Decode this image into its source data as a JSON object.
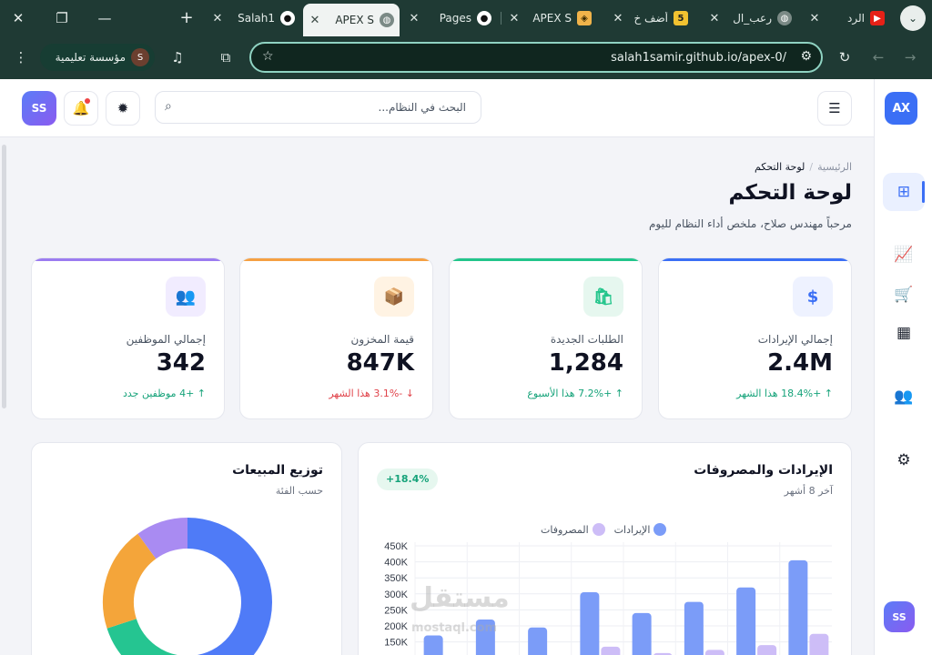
{
  "browser": {
    "tabs": [
      {
        "title": "Salah1",
        "favicon": "github-icon",
        "active": false
      },
      {
        "title": "APEX S",
        "favicon": "globe-icon",
        "active": true
      },
      {
        "title": "Pages",
        "favicon": "github-icon",
        "active": false
      },
      {
        "title": "APEX S",
        "favicon": "codepen-icon",
        "active": false
      },
      {
        "title": "أضف خ",
        "favicon": "five-icon",
        "active": false
      },
      {
        "title": "رعب_ال",
        "favicon": "globe-icon",
        "active": false
      },
      {
        "title": "الرد",
        "favicon": "youtube-icon",
        "active": false
      }
    ],
    "url": "salah1samir.github.io/apex-0/",
    "profile_name": "مؤسسة تعليمية",
    "profile_initial": "S"
  },
  "app": {
    "logo": "AX",
    "user_initials": "SS",
    "search_placeholder": "البحث في النظام...",
    "breadcrumb": {
      "home": "الرئيسية",
      "current": "لوحة التحكم"
    },
    "title": "لوحة التحكم",
    "subtitle": "مرحباً مهندس صلاح، ملخص أداء النظام لليوم",
    "sidebar_icons": [
      "dashboard-icon",
      "chart-icon",
      "cart-icon",
      "boxes-icon",
      "users-icon",
      "settings-icon"
    ]
  },
  "stats": [
    {
      "label": "إجمالي الإيرادات",
      "value": "2.4M",
      "trend": "+18.4% هذا الشهر",
      "direction": "up",
      "icon": "$",
      "accent": "#3b6ff5",
      "icon_bg": "#eef2ff"
    },
    {
      "label": "الطلبات الجديدة",
      "value": "1,284",
      "trend": "+7.2% هذا الأسبوع",
      "direction": "up",
      "icon": "🛍",
      "accent": "#22c58b",
      "icon_bg": "#e6f7ef"
    },
    {
      "label": "قيمة المخزون",
      "value": "847K",
      "trend": "-3.1% هذا الشهر",
      "direction": "down",
      "icon": "📦",
      "accent": "#f5a043",
      "icon_bg": "#fff3e3"
    },
    {
      "label": "إجمالي الموظفين",
      "value": "342",
      "trend": "+4 موظفين جدد",
      "direction": "up",
      "icon": "👥",
      "accent": "#9b7cf0",
      "icon_bg": "#f1ecff"
    }
  ],
  "revenue_panel": {
    "title": "الإيرادات والمصروفات",
    "subtitle": "آخر 8 أشهر",
    "badge": "+18.4%"
  },
  "sales_panel": {
    "title": "توزيع المبيعات",
    "subtitle": "حسب الفئة"
  },
  "chart_data": [
    {
      "type": "bar",
      "series": [
        {
          "name": "الإيرادات",
          "color": "#7b9cf8",
          "values": [
            170000,
            220000,
            195000,
            305000,
            240000,
            275000,
            320000,
            405000
          ]
        },
        {
          "name": "المصروفات",
          "color": "#cdbdf7",
          "values": [
            null,
            null,
            null,
            135000,
            115000,
            125000,
            140000,
            175000
          ]
        }
      ],
      "y_ticks": [
        "450K",
        "400K",
        "350K",
        "300K",
        "250K",
        "200K",
        "150K"
      ],
      "ylim": [
        150000,
        450000
      ],
      "grid": true,
      "legend_position": "top"
    },
    {
      "type": "pie",
      "variant": "donut",
      "slices": [
        {
          "color": "#4f7bf7",
          "value": 50
        },
        {
          "color": "#25c591",
          "value": 20
        },
        {
          "color": "#f4a53a",
          "value": 20
        },
        {
          "color": "#a98bf2",
          "value": 10
        }
      ]
    }
  ],
  "watermark": {
    "text": "مستقل",
    "sub": "mostaql.com"
  }
}
